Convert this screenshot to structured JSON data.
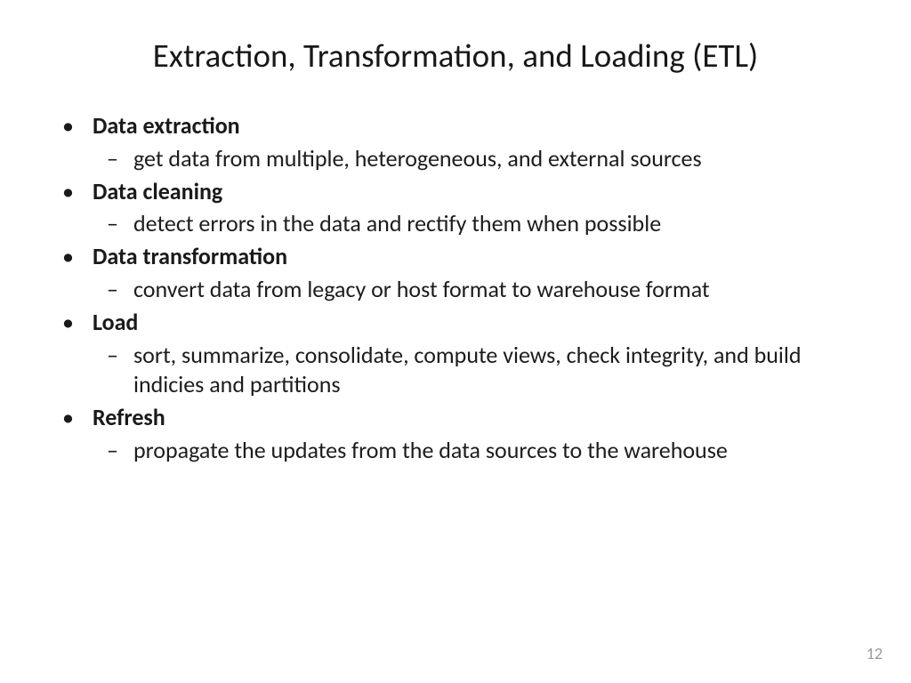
{
  "slide": {
    "title": "Extraction, Transformation, and Loading (ETL)",
    "items": [
      {
        "label": "Data extraction",
        "sub": "get data from multiple, heterogeneous, and external sources"
      },
      {
        "label": "Data cleaning",
        "sub": "detect errors in the data and rectify them when possible"
      },
      {
        "label": "Data transformation",
        "sub": "convert data from legacy or host format to warehouse format"
      },
      {
        "label": "Load",
        "sub": "sort, summarize, consolidate, compute views, check integrity, and build indicies and partitions"
      },
      {
        "label": "Refresh",
        "sub": "propagate the updates from the data sources to the warehouse"
      }
    ],
    "page_number": "12"
  }
}
